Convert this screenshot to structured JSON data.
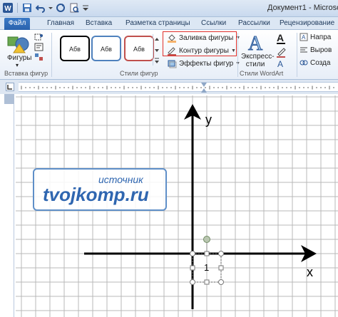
{
  "title_bar": {
    "app_icon": "W",
    "document_title": "Документ1 - Microso",
    "quick_access": [
      "save-icon",
      "undo-icon",
      "redo-icon",
      "print-preview-icon",
      "customize-icon"
    ]
  },
  "tabs": [
    {
      "label": "Файл",
      "active": false
    },
    {
      "label": "Главная",
      "active": false
    },
    {
      "label": "Вставка",
      "active": false
    },
    {
      "label": "Разметка страницы",
      "active": false
    },
    {
      "label": "Ссылки",
      "active": false
    },
    {
      "label": "Рассылки",
      "active": false
    },
    {
      "label": "Рецензирование",
      "active": false
    }
  ],
  "ribbon": {
    "insert_shapes": {
      "shapes_label": "Фигуры",
      "group_label": "Вставка фигур"
    },
    "shape_styles": {
      "samples": [
        "Абв",
        "Абв",
        "Абв"
      ],
      "sample_colors": [
        "#000000",
        "#4f81bd",
        "#c0504d"
      ],
      "fill_label": "Заливка фигуры",
      "outline_label": "Контур фигуры",
      "effects_label": "Эффекты фигур",
      "group_label": "Стили фигур"
    },
    "wordart": {
      "express_styles_label": "Экспресс-стили",
      "express_line1": "Экспресс-",
      "express_line2": "стили",
      "group_label": "Стили WordArt"
    },
    "text": {
      "direction_label": "Напра",
      "align_label": "Выров",
      "link_label": "Созда"
    }
  },
  "document": {
    "y_axis_label": "y",
    "x_axis_label": "x",
    "selected_shape_text": "1"
  },
  "watermark": {
    "line1": "источник",
    "line2": "tvojkomp.ru"
  },
  "colors": {
    "accent": "#2b5797",
    "highlight_box": "#e0302a",
    "grid": "#b8b8b8",
    "watermark": "#2f66b0"
  }
}
